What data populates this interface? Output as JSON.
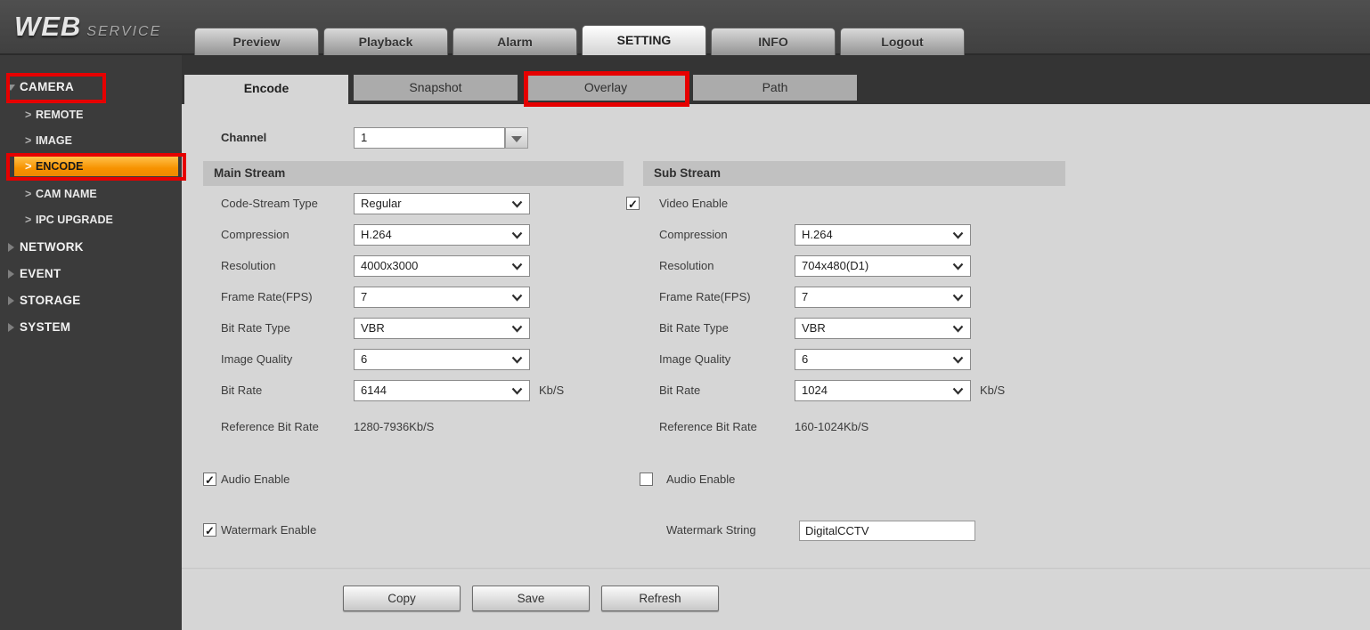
{
  "brand": {
    "title_primary": "WEB",
    "title_secondary": "SERVICE"
  },
  "nav": {
    "tabs": [
      {
        "label": "Preview",
        "active": false
      },
      {
        "label": "Playback",
        "active": false
      },
      {
        "label": "Alarm",
        "active": false
      },
      {
        "label": "SETTING",
        "active": true
      },
      {
        "label": "INFO",
        "active": false
      },
      {
        "label": "Logout",
        "active": false
      }
    ]
  },
  "sidebar": {
    "item_chevron": ">",
    "camera": {
      "label": "CAMERA",
      "items": [
        {
          "label": "REMOTE",
          "active": false
        },
        {
          "label": "IMAGE",
          "active": false
        },
        {
          "label": "ENCODE",
          "active": true
        },
        {
          "label": "CAM NAME",
          "active": false
        },
        {
          "label": "IPC UPGRADE",
          "active": false
        }
      ]
    },
    "groups": [
      {
        "label": "NETWORK"
      },
      {
        "label": "EVENT"
      },
      {
        "label": "STORAGE"
      },
      {
        "label": "SYSTEM"
      }
    ]
  },
  "content": {
    "tabs": [
      {
        "label": "Encode",
        "active": true
      },
      {
        "label": "Snapshot",
        "active": false
      },
      {
        "label": "Overlay",
        "active": false
      },
      {
        "label": "Path",
        "active": false
      }
    ],
    "channel": {
      "label": "Channel",
      "value": "1"
    },
    "main_stream": {
      "title": "Main Stream",
      "fields": [
        {
          "label": "Code-Stream Type",
          "value": "Regular"
        },
        {
          "label": "Compression",
          "value": "H.264"
        },
        {
          "label": "Resolution",
          "value": "4000x3000"
        },
        {
          "label": "Frame Rate(FPS)",
          "value": "7"
        },
        {
          "label": "Bit Rate Type",
          "value": "VBR"
        },
        {
          "label": "Image Quality",
          "value": "6"
        },
        {
          "label": "Bit Rate",
          "value": "6144",
          "suffix": "Kb/S"
        }
      ],
      "reference": {
        "label": "Reference Bit Rate",
        "value": "1280-7936Kb/S"
      },
      "audio_enable": {
        "label": "Audio Enable",
        "checked": true,
        "mark": "✓"
      },
      "watermark_enable": {
        "label": "Watermark Enable",
        "checked": true,
        "mark": "✓"
      }
    },
    "sub_stream": {
      "title": "Sub Stream",
      "video_enable": {
        "label": "Video Enable",
        "checked": true,
        "mark": "✓"
      },
      "fields": [
        {
          "label": "Compression",
          "value": "H.264"
        },
        {
          "label": "Resolution",
          "value": "704x480(D1)"
        },
        {
          "label": "Frame Rate(FPS)",
          "value": "7"
        },
        {
          "label": "Bit Rate Type",
          "value": "VBR"
        },
        {
          "label": "Image Quality",
          "value": "6"
        },
        {
          "label": "Bit Rate",
          "value": "1024",
          "suffix": "Kb/S"
        }
      ],
      "reference": {
        "label": "Reference Bit Rate",
        "value": "160-1024Kb/S"
      },
      "audio_enable": {
        "label": "Audio Enable",
        "checked": false,
        "mark": ""
      },
      "watermark_string": {
        "label": "Watermark String",
        "value": "DigitalCCTV"
      }
    },
    "buttons": [
      {
        "label": "Copy"
      },
      {
        "label": "Save"
      },
      {
        "label": "Refresh"
      }
    ]
  },
  "annotation": {
    "color": "#e60000"
  }
}
